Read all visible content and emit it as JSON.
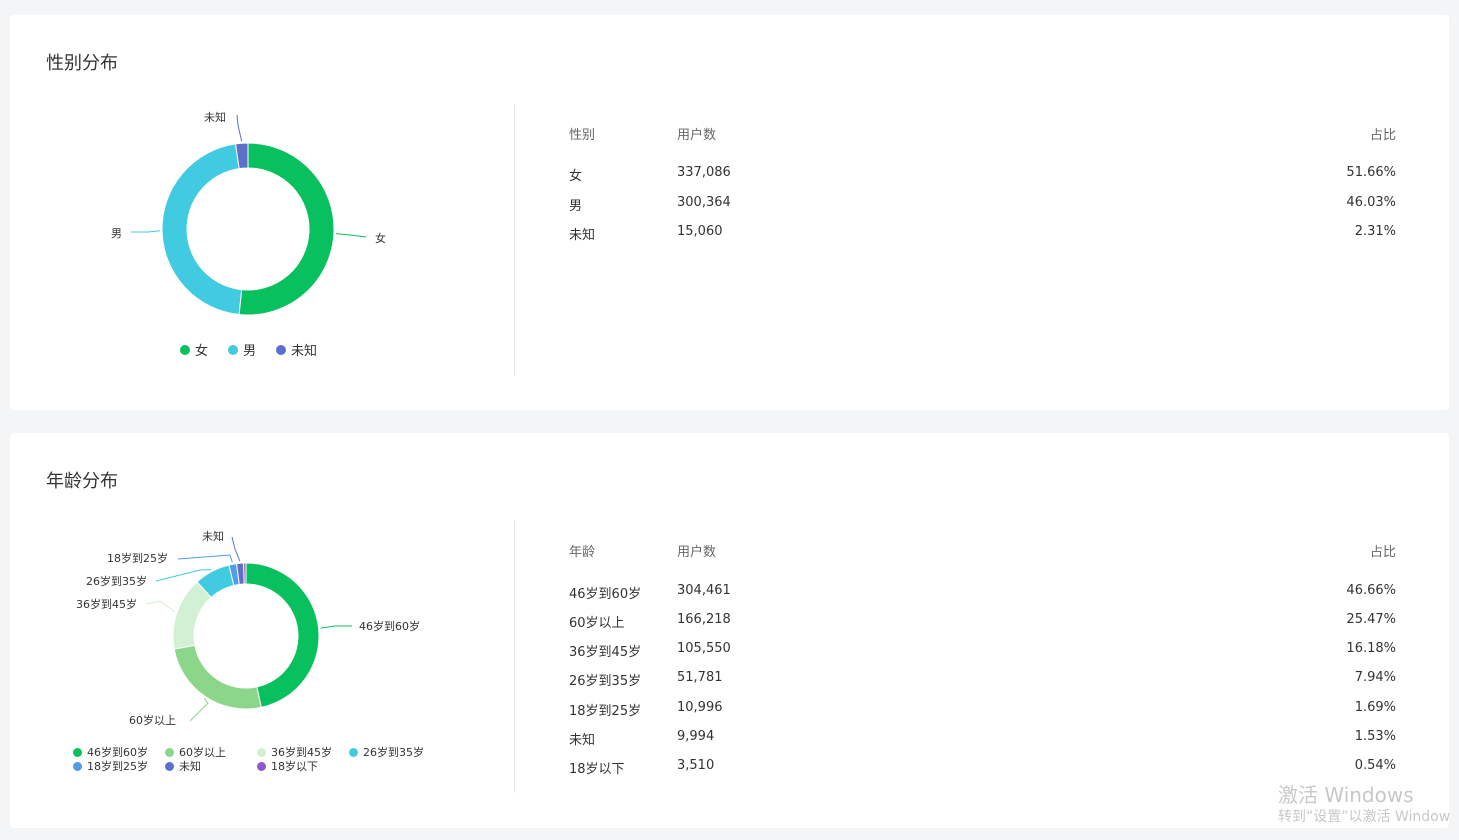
{
  "gender": {
    "title": "性别分布",
    "headers": {
      "col1": "性别",
      "col2": "用户数",
      "col3": "占比"
    },
    "rows": [
      {
        "label": "女",
        "count": "337,086",
        "pct": "51.66%"
      },
      {
        "label": "男",
        "count": "300,364",
        "pct": "46.03%"
      },
      {
        "label": "未知",
        "count": "15,060",
        "pct": "2.31%"
      }
    ],
    "legend": [
      "女",
      "男",
      "未知"
    ]
  },
  "age": {
    "title": "年龄分布",
    "headers": {
      "col1": "年龄",
      "col2": "用户数",
      "col3": "占比"
    },
    "rows": [
      {
        "label": "46岁到60岁",
        "count": "304,461",
        "pct": "46.66%"
      },
      {
        "label": "60岁以上",
        "count": "166,218",
        "pct": "25.47%"
      },
      {
        "label": "36岁到45岁",
        "count": "105,550",
        "pct": "16.18%"
      },
      {
        "label": "26岁到35岁",
        "count": "51,781",
        "pct": "7.94%"
      },
      {
        "label": "18岁到25岁",
        "count": "10,996",
        "pct": "1.69%"
      },
      {
        "label": "未知",
        "count": "9,994",
        "pct": "1.53%"
      },
      {
        "label": "18岁以下",
        "count": "3,510",
        "pct": "0.54%"
      }
    ],
    "legend": [
      "46岁到60岁",
      "60岁以上",
      "36岁到45岁",
      "26岁到35岁",
      "18岁到25岁",
      "未知",
      "18岁以下"
    ]
  },
  "chart_data": [
    {
      "type": "pie",
      "variant": "donut",
      "categories": [
        "女",
        "男",
        "未知"
      ],
      "values": [
        337086,
        300364,
        15060
      ],
      "colors": [
        "#08c05e",
        "#40cbe0",
        "#5c6fcb"
      ],
      "legend_position": "bottom"
    },
    {
      "type": "pie",
      "variant": "donut",
      "categories": [
        "46岁到60岁",
        "60岁以上",
        "36岁到45岁",
        "26岁到35岁",
        "18岁到25岁",
        "未知",
        "18岁以下"
      ],
      "values": [
        304461,
        166218,
        105550,
        51781,
        10996,
        9994,
        3510
      ],
      "colors": [
        "#08c05e",
        "#8bd68a",
        "#d2f0d3",
        "#40cbe0",
        "#4f9de6",
        "#5c6fcb",
        "#8e5ac9"
      ],
      "legend_position": "bottom"
    }
  ],
  "watermark": {
    "line1": "激活 Windows",
    "line2": "转到“设置”以激活 Window"
  }
}
